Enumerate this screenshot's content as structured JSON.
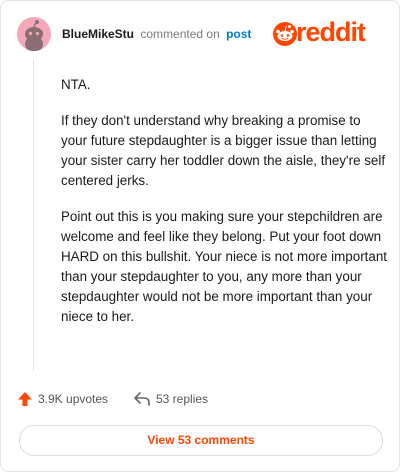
{
  "comment": {
    "username": "BlueMikeStu",
    "action": "commented on",
    "target": "post",
    "paragraphs": [
      "NTA.",
      "If they don't understand why breaking a promise to your future stepdaughter is a bigger issue than letting your sister carry her toddler down the aisle, they're self centered jerks.",
      "Point out this is you making sure your stepchildren are welcome and feel like they belong. Put your foot down HARD on this bullshit. Your niece is not more important than your stepdaughter to you, any more than your stepdaughter would not be more important than your niece to her."
    ]
  },
  "brand": {
    "name": "reddit",
    "color": "#ff4500"
  },
  "stats": {
    "upvotes": "3.9K upvotes",
    "replies": "53 replies",
    "upvote_icon": "upvote-arrow-icon",
    "reply_icon": "reply-arrow-icon"
  },
  "actions": {
    "view_comments": "View 53 comments"
  },
  "avatar": {
    "color": "#f6a8bb"
  }
}
